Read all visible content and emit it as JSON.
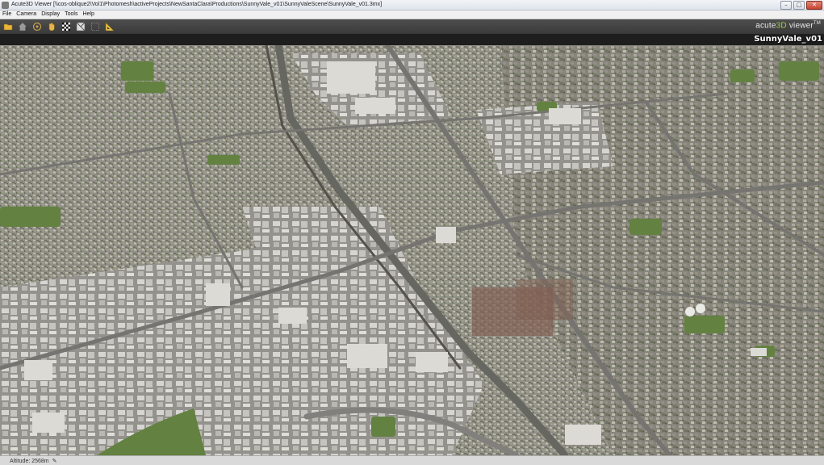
{
  "window": {
    "title": "Acute3D Viewer [\\\\cos-oblique2\\Vol1\\Photomesh\\activeProjects\\NewSantaClara\\Productions\\SunnyVale_v01\\SunnyValeScene\\SunnyVale_v01.3mx]",
    "controls": [
      "–",
      "□",
      "✕"
    ]
  },
  "menu": {
    "items": [
      "File",
      "Camera",
      "Display",
      "Tools",
      "Help"
    ]
  },
  "toolbar": {
    "tools": [
      {
        "name": "open-folder-icon"
      },
      {
        "name": "home-view-icon"
      },
      {
        "name": "orbit-icon"
      },
      {
        "name": "pan-hand-icon"
      },
      {
        "name": "checkerboard-icon"
      },
      {
        "name": "wireframe-icon"
      },
      {
        "name": "selection-icon"
      },
      {
        "name": "measure-icon"
      }
    ],
    "brand_prefix": "acute",
    "brand_3d": "3D",
    "brand_suffix": " viewer",
    "brand_tm": "TM"
  },
  "scene": {
    "label": "SunnyVale_v01"
  },
  "status": {
    "altitude": "Altitude: 2568m"
  },
  "colors": {
    "toolbar_bg": "#444444",
    "brand_accent": "#9ccf3c",
    "viewport_base": "#8a8a82",
    "vegetation": "#5b7a3a",
    "roofs": "#c9c9c4"
  }
}
